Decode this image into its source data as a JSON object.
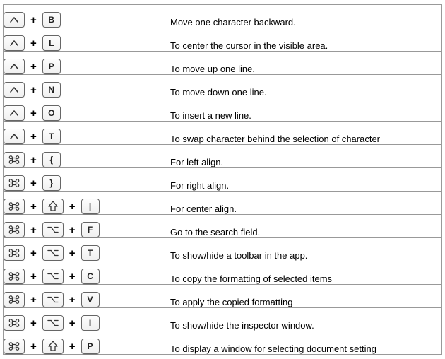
{
  "modifiers": {
    "ctrl": {
      "glyph": "ctrl",
      "name": "control-key"
    },
    "cmd": {
      "glyph": "cmd",
      "name": "command-key"
    },
    "shift": {
      "glyph": "shift",
      "name": "shift-key"
    },
    "option": {
      "glyph": "option",
      "name": "option-key"
    }
  },
  "rows": [
    {
      "keys": [
        "ctrl",
        "B"
      ],
      "description": "Move one character backward."
    },
    {
      "keys": [
        "ctrl",
        "L"
      ],
      "description": "To center the cursor in the visible area."
    },
    {
      "keys": [
        "ctrl",
        "P"
      ],
      "description": "To move up one line."
    },
    {
      "keys": [
        "ctrl",
        "N"
      ],
      "description": "To move down one line."
    },
    {
      "keys": [
        "ctrl",
        "O"
      ],
      "description": "To insert a new line."
    },
    {
      "keys": [
        "ctrl",
        "T"
      ],
      "description": "To swap character behind the selection of character"
    },
    {
      "keys": [
        "cmd",
        "{"
      ],
      "description": "For left align."
    },
    {
      "keys": [
        "cmd",
        "}"
      ],
      "description": "For right align."
    },
    {
      "keys": [
        "cmd",
        "shift",
        "|"
      ],
      "description": "For center align."
    },
    {
      "keys": [
        "cmd",
        "option",
        "F"
      ],
      "description": "Go to the search field."
    },
    {
      "keys": [
        "cmd",
        "option",
        "T"
      ],
      "description": "To show/hide a toolbar in the app."
    },
    {
      "keys": [
        "cmd",
        "option",
        "C"
      ],
      "description": "To copy the formatting of selected items"
    },
    {
      "keys": [
        "cmd",
        "option",
        "V"
      ],
      "description": "To apply the copied formatting"
    },
    {
      "keys": [
        "cmd",
        "option",
        "I"
      ],
      "description": "To show/hide the inspector window."
    },
    {
      "keys": [
        "cmd",
        "shift",
        "P"
      ],
      "description": "To display a window for selecting document setting"
    }
  ]
}
